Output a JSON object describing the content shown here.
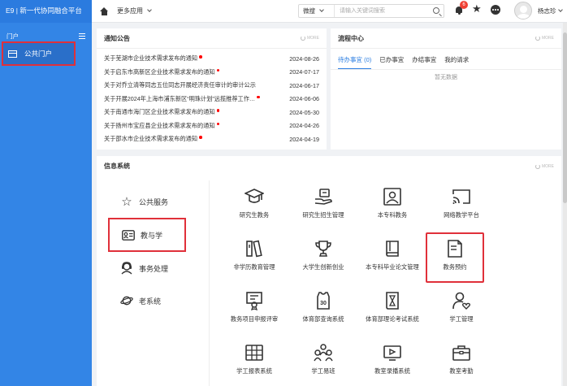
{
  "sidebar": {
    "title": "E9 | 新一代协同融合平台",
    "section_label": "门户",
    "items": [
      {
        "label": "公共门户"
      }
    ]
  },
  "header": {
    "more_apps": "更多应用",
    "search_scope": "微搜",
    "search_placeholder": "请输入关键词搜索",
    "notification_count": "6",
    "username": "杨志珍"
  },
  "notices": {
    "title": "通知公告",
    "more": "MORE",
    "items": [
      {
        "title": "关于芜湖市企业技术需求发布的通知",
        "date": "2024-08-26",
        "new": true
      },
      {
        "title": "关于启东市高新区企业技术需求发布的通知",
        "date": "2024-07-17",
        "new": true
      },
      {
        "title": "关于对乔立清等同志五位同志开展经济责任审计的审计公示",
        "date": "2024-06-17",
        "new": false
      },
      {
        "title": "关于开展2024年上海市浦东新区“明珠计划”远揽推荐工作…",
        "date": "2024-06-06",
        "new": true
      },
      {
        "title": "关于南通市海门区企业技术需求发布的通知",
        "date": "2024-05-30",
        "new": true
      },
      {
        "title": "关于扬州市宝应县企业技术需求发布的通知",
        "date": "2024-04-26",
        "new": true
      },
      {
        "title": "关于邵水市企业技术需求发布的通知",
        "date": "2024-04-19",
        "new": true
      }
    ]
  },
  "workflow": {
    "title": "流程中心",
    "more": "MORE",
    "tabs": [
      {
        "label": "待办事宜 (0)",
        "active": true
      },
      {
        "label": "已办事宜",
        "active": false
      },
      {
        "label": "办结事宜",
        "active": false
      },
      {
        "label": "我的请求",
        "active": false
      }
    ],
    "empty_text": "暂无数据"
  },
  "info": {
    "title": "信息系统",
    "more": "MORE",
    "categories": [
      {
        "label": "公共服务",
        "icon": "star-outline-icon",
        "active": false
      },
      {
        "label": "教与学",
        "icon": "id-card-icon",
        "active": true
      },
      {
        "label": "事务处理",
        "icon": "headset-icon",
        "active": false
      },
      {
        "label": "老系统",
        "icon": "planet-icon",
        "active": false
      }
    ],
    "tiles": [
      {
        "label": "研究生教务",
        "icon": "graduation-cap-icon"
      },
      {
        "label": "研究生招生管理",
        "icon": "hand-card-icon"
      },
      {
        "label": "本专科教务",
        "icon": "portrait-frame-icon"
      },
      {
        "label": "网络教学平台",
        "icon": "cast-screen-icon"
      },
      {
        "label": "非学历教育管理",
        "icon": "books-icon"
      },
      {
        "label": "大学生创新创业",
        "icon": "trophy-icon"
      },
      {
        "label": "本专科毕业论文管理",
        "icon": "book-icon"
      },
      {
        "label": "教务预约",
        "icon": "document-icon"
      },
      {
        "label": "教务项目申报评审",
        "icon": "certificate-icon"
      },
      {
        "label": "体育部查询系统",
        "icon": "jersey-icon"
      },
      {
        "label": "体育部理论考试系统",
        "icon": "hourglass-icon"
      },
      {
        "label": "学工管理",
        "icon": "user-heart-icon"
      },
      {
        "label": "学工报表系统",
        "icon": "table-icon"
      },
      {
        "label": "学工易班",
        "icon": "group-icon"
      },
      {
        "label": "教室录播系统",
        "icon": "video-icon"
      },
      {
        "label": "教室考勤",
        "icon": "toolbox-icon"
      }
    ]
  }
}
